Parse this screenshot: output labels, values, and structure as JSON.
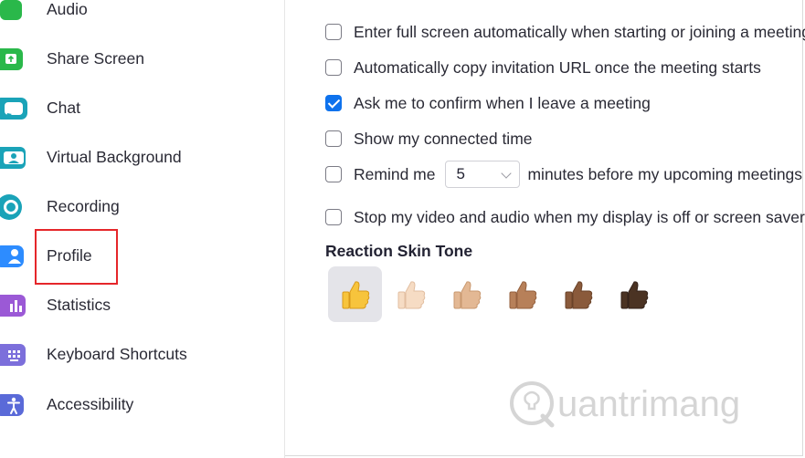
{
  "sidebar": {
    "items": [
      {
        "label": "Audio",
        "icon": "headphones-icon",
        "color": "#2ab84a"
      },
      {
        "label": "Share Screen",
        "icon": "share-screen-icon",
        "color": "#2ab84a"
      },
      {
        "label": "Chat",
        "icon": "chat-icon",
        "color": "#1aa3b8"
      },
      {
        "label": "Virtual Background",
        "icon": "virtual-background-icon",
        "color": "#1aa3b8"
      },
      {
        "label": "Recording",
        "icon": "recording-icon",
        "color": "#1aa3b8"
      },
      {
        "label": "Profile",
        "icon": "profile-icon",
        "color": "#2d8cff"
      },
      {
        "label": "Statistics",
        "icon": "statistics-icon",
        "color": "#9b59d6"
      },
      {
        "label": "Keyboard Shortcuts",
        "icon": "keyboard-icon",
        "color": "#7c6fdb"
      },
      {
        "label": "Accessibility",
        "icon": "accessibility-icon",
        "color": "#5a6ad8"
      }
    ]
  },
  "options": {
    "fullscreen": {
      "label": "Enter full screen automatically when starting or joining a meeting",
      "checked": false
    },
    "copy_url": {
      "label": "Automatically copy invitation URL once the meeting starts",
      "checked": false
    },
    "confirm_leave": {
      "label": "Ask me to confirm when I leave a meeting",
      "checked": true
    },
    "connected_time": {
      "label": "Show my connected time",
      "checked": false
    },
    "remind": {
      "label_before": "Remind me",
      "minutes": "5",
      "label_after": "minutes before my upcoming meetings",
      "checked": false
    },
    "stop_video": {
      "label": "Stop my video and audio when my display is off or screen saver begins",
      "checked": false
    }
  },
  "reaction": {
    "title": "Reaction Skin Tone",
    "tones": [
      {
        "name": "default",
        "color": "#f7c43c",
        "selected": true
      },
      {
        "name": "light",
        "color": "#f6dcc4",
        "selected": false
      },
      {
        "name": "medium-light",
        "color": "#e3b894",
        "selected": false
      },
      {
        "name": "medium",
        "color": "#b78059",
        "selected": false
      },
      {
        "name": "medium-dark",
        "color": "#8a5a3b",
        "selected": false
      },
      {
        "name": "dark",
        "color": "#4b3323",
        "selected": false
      }
    ]
  },
  "watermark": {
    "text": "uantrimang"
  },
  "colors": {
    "accent": "#0e72ed",
    "highlight": "#e5262a"
  }
}
